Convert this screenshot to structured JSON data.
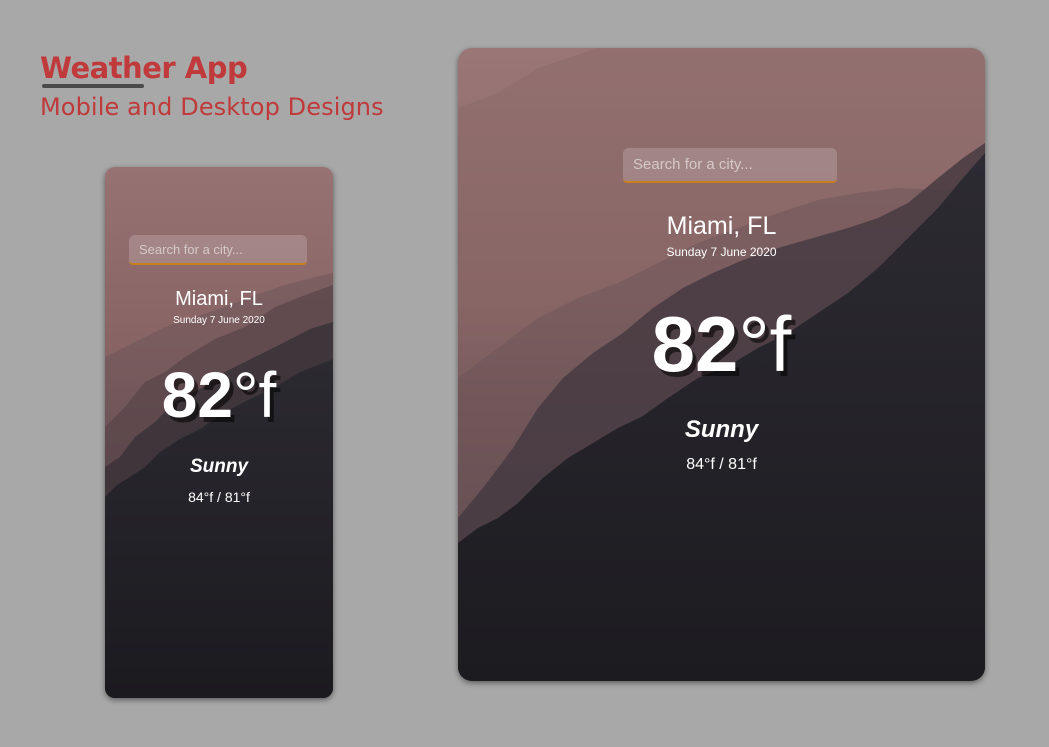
{
  "header": {
    "title": "Weather App",
    "subtitle": "Mobile and Desktop  Designs"
  },
  "mobile": {
    "search_placeholder": "Search for a city...",
    "city": "Miami, FL",
    "date": "Sunday 7 June 2020",
    "temp_value": "82",
    "temp_unit": "°f",
    "condition": "Sunny",
    "range": "84°f / 81°f"
  },
  "desktop": {
    "search_placeholder": "Search for a city...",
    "city": "Miami, FL",
    "date": "Sunday 7 June 2020",
    "temp_value": "82",
    "temp_unit": "°f",
    "condition": "Sunny",
    "range": "84°f / 81°f"
  },
  "colors": {
    "page_background": "#a8a8a8",
    "heading_red": "#c0393b",
    "sky_top": "#9a7474",
    "mountain_dark": "#1e1c22",
    "search_underline": "#c97f1d"
  },
  "icons": {
    "background": "misty-mountain-forest-image"
  }
}
